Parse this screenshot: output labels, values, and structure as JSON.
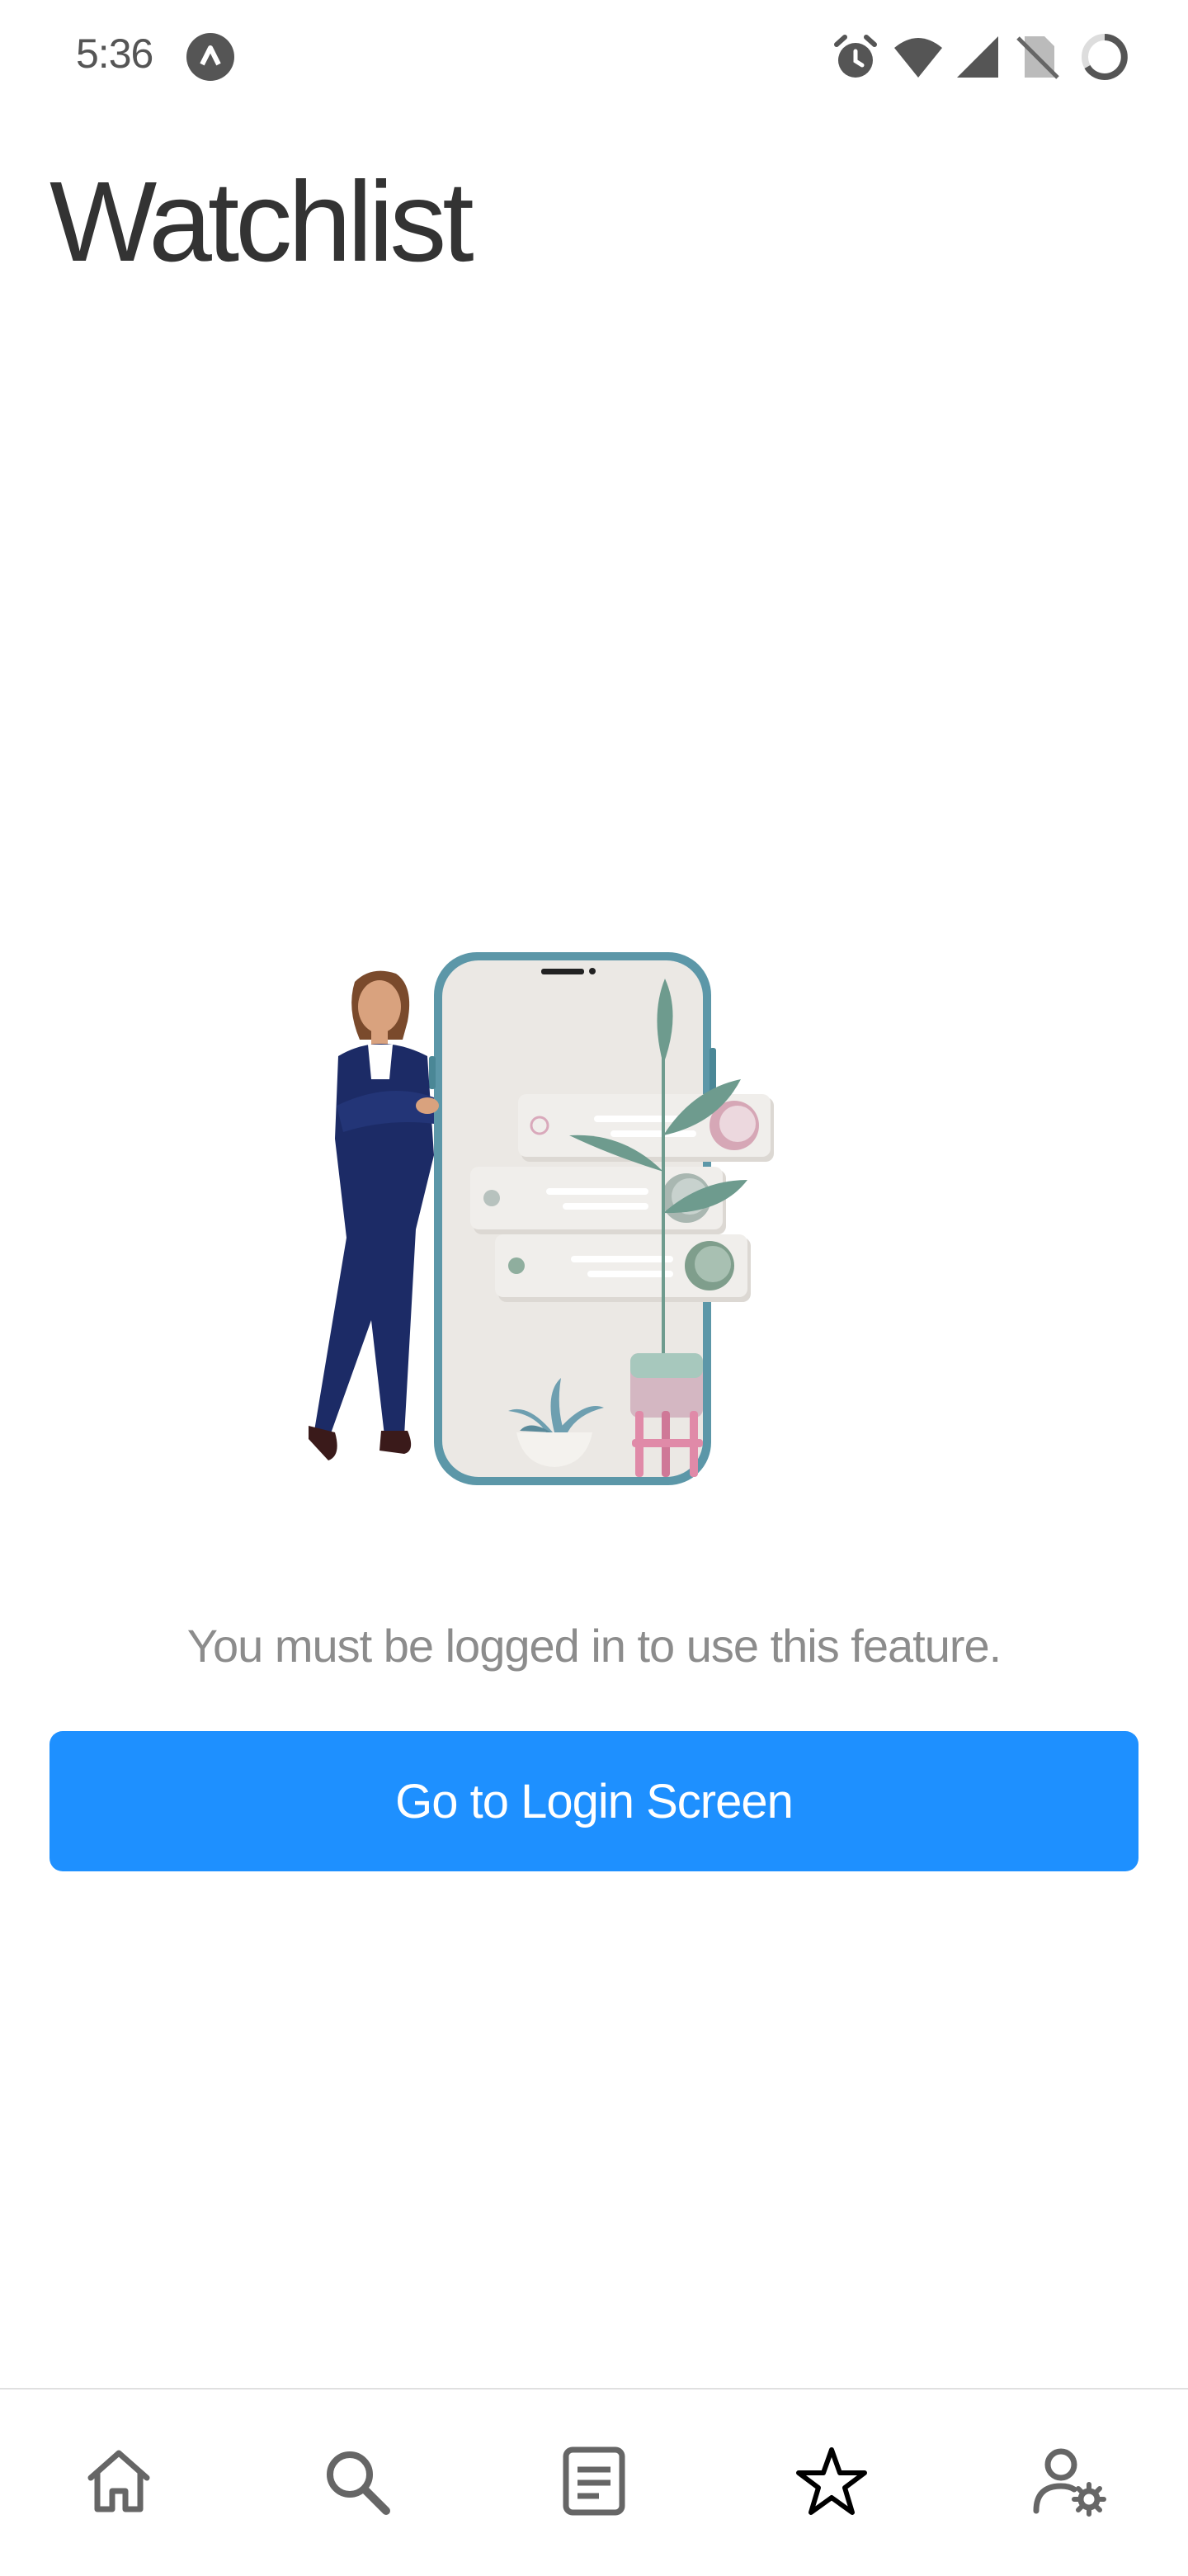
{
  "status_bar": {
    "time": "5:36",
    "icons": [
      "app-notification-icon",
      "alarm-icon",
      "wifi-icon",
      "cell-signal-icon",
      "no-sim-icon",
      "battery-icon"
    ]
  },
  "header": {
    "title": "Watchlist"
  },
  "main": {
    "illustration": "woman-leaning-on-phone-with-plants-illustration",
    "message": "You must be logged in to use this feature.",
    "login_button": "Go to Login Screen"
  },
  "bottom_nav": {
    "tabs": [
      {
        "icon": "home-icon"
      },
      {
        "icon": "search-icon"
      },
      {
        "icon": "news-icon"
      },
      {
        "icon": "star-icon",
        "selected": true
      },
      {
        "icon": "user-settings-icon"
      }
    ]
  },
  "colors": {
    "accent": "#1e90ff",
    "title": "#333333",
    "message": "#8c8c8c",
    "icon": "#666666",
    "active_icon": "#000000"
  }
}
